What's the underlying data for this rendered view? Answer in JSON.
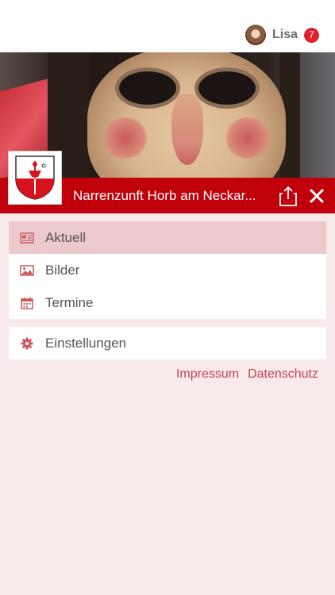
{
  "header": {
    "user_name": "Lisa",
    "notification_count": "7"
  },
  "club": {
    "title": "Narrenzunft Horb am Neckar..."
  },
  "menu": {
    "items": [
      {
        "label": "Aktuell",
        "icon": "newspaper-icon",
        "active": true
      },
      {
        "label": "Bilder",
        "icon": "image-icon",
        "active": false
      },
      {
        "label": "Termine",
        "icon": "calendar-icon",
        "active": false
      }
    ],
    "settings": {
      "label": "Einstellungen",
      "icon": "gear-icon"
    }
  },
  "footer_links": {
    "impressum": "Impressum",
    "datenschutz": "Datenschutz"
  },
  "colors": {
    "brand_red": "#c0000b",
    "menu_icon": "#c9585c",
    "background": "#f8eaea",
    "active_item": "#ecc9ca"
  }
}
